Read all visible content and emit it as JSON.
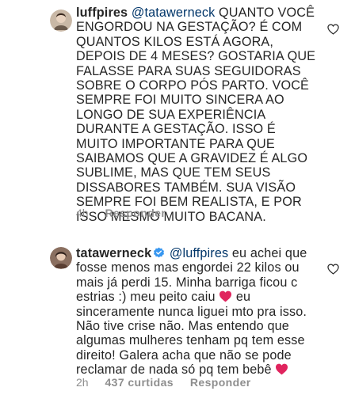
{
  "comments": [
    {
      "username": "luffpires",
      "mention": "@tatawerneck",
      "text": " QUANTO VOCÊ ENGORDOU NA GESTAÇÃO? É COM QUANTOS KILOS ESTÁ AGORA, DEPOIS DE 4 MESES? GOSTARIA QUE FALASSE PARA SUAS SEGUIDORAS SOBRE O CORPO PÓS PARTO. VOCÊ SEMPRE FOI MUITO SINCERA AO LONGO DE SUA EXPERIÊNCIA DURANTE A GESTAÇÃO. ISSO É MUITO IMPORTANTE PARA QUE SAIBAMOS QUE A GRAVIDEZ É ALGO SUBLIME, MAS QUE TEM SEUS DISSABORES TAMBÉM. SUA VISÃO SEMPRE FOI BEM REALISTA, E POR ISSO MESMO MUITO BACANA.",
      "time": "4h",
      "reply_label": "Responder"
    },
    {
      "username": "tatawerneck",
      "mention": "@luffpires",
      "text_a": " eu achei que fosse menos mas engordei 22 kilos ou mais já perdi 15. Minha barriga ficou c estrias :) meu peito caiu ",
      "text_b": " eu sinceramente nunca liguei mto pra isso. Não tive crise não. Mas entendo que algumas mulheres tenham pq tem esse direito! Galera acha que não se pode reclamar de nada só pq tem bebê ",
      "time": "2h",
      "likes_label": "437 curtidas",
      "reply_label": "Responder"
    }
  ],
  "icons": {
    "like": "heart-outline-icon",
    "verified": "verified-badge-icon",
    "emoji": "red-heart-emoji"
  },
  "colors": {
    "text": "#262626",
    "mention": "#003569",
    "meta": "#8e8e8e",
    "verified": "#3897f0",
    "heart_emoji": "#e0245e"
  }
}
